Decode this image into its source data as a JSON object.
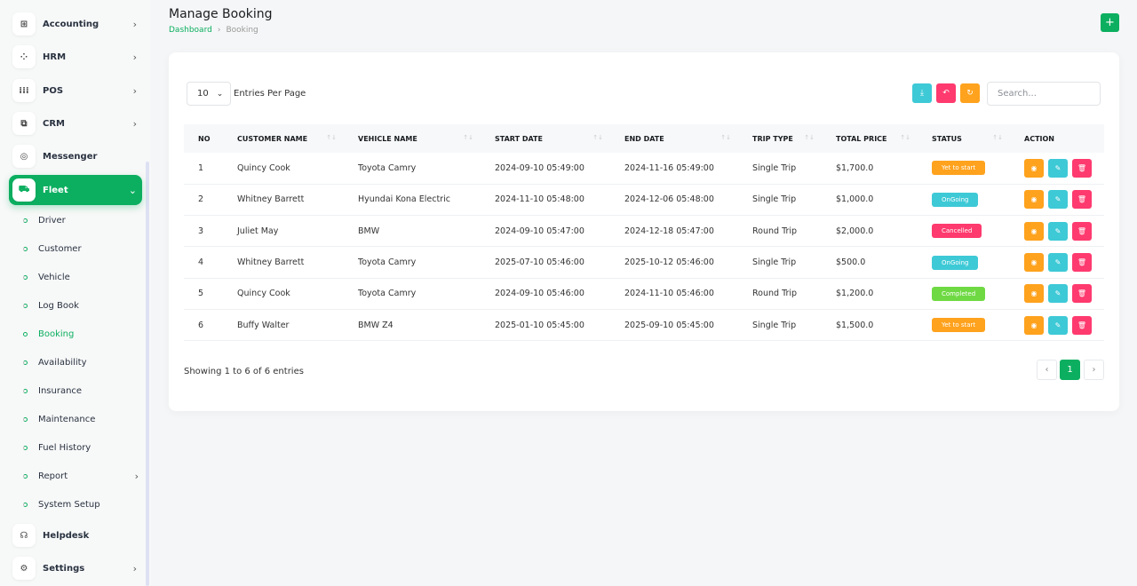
{
  "sidebar": {
    "items": [
      {
        "label": "Accounting",
        "icon": "grid-plus-icon",
        "glyph": "⊞",
        "has_chevron": true
      },
      {
        "label": "HRM",
        "icon": "users-circle-icon",
        "glyph": "⁘",
        "has_chevron": true
      },
      {
        "label": "POS",
        "icon": "dots-grid-icon",
        "glyph": "⁞⁞⁞",
        "has_chevron": true
      },
      {
        "label": "CRM",
        "icon": "layers-icon",
        "glyph": "⧉",
        "has_chevron": true
      },
      {
        "label": "Messenger",
        "icon": "chat-icon",
        "glyph": "◎",
        "has_chevron": false
      },
      {
        "label": "Fleet",
        "icon": "car-icon",
        "glyph": "⛟",
        "has_chevron": true,
        "active": true
      }
    ],
    "fleet_sub": [
      {
        "label": "Driver"
      },
      {
        "label": "Customer"
      },
      {
        "label": "Vehicle"
      },
      {
        "label": "Log Book"
      },
      {
        "label": "Booking",
        "active": true
      },
      {
        "label": "Availability"
      },
      {
        "label": "Insurance"
      },
      {
        "label": "Maintenance"
      },
      {
        "label": "Fuel History"
      },
      {
        "label": "Report",
        "has_chevron": true
      },
      {
        "label": "System Setup"
      }
    ],
    "bottom_items": [
      {
        "label": "Helpdesk",
        "icon": "headphones-icon",
        "glyph": "☊",
        "has_chevron": false
      },
      {
        "label": "Settings",
        "icon": "gear-icon",
        "glyph": "⚙",
        "has_chevron": true
      }
    ],
    "chevron_right": "›",
    "chevron_down": "⌄"
  },
  "header": {
    "title": "Manage Booking",
    "breadcrumb": {
      "home": "Dashboard",
      "separator": "›",
      "current": "Booking"
    },
    "add_glyph": "+"
  },
  "toolbar": {
    "per_page_value": "10",
    "per_page_caret": "⌄",
    "per_page_label": "Entries Per Page",
    "search_placeholder": "Search...",
    "buttons": [
      {
        "name": "export",
        "glyph": "⤓",
        "color": "#3ec9d6"
      },
      {
        "name": "reset",
        "glyph": "↶",
        "color": "#ff3a6e"
      },
      {
        "name": "refresh",
        "glyph": "↻",
        "color": "#ffa21d"
      }
    ]
  },
  "table": {
    "columns": [
      "No",
      "Customer Name",
      "Vehicle Name",
      "Start Date",
      "End Date",
      "Trip Type",
      "Total Price",
      "Status",
      "Action"
    ],
    "sort_glyph": "↑↓",
    "rows": [
      {
        "no": "1",
        "customer": "Quincy Cook",
        "vehicle": "Toyota Camry",
        "start": "2024-09-10 05:49:00",
        "end": "2024-11-16 05:49:00",
        "trip": "Single Trip",
        "price": "$1,700.0",
        "status": "Yet to start",
        "status_color": "#ffa21d"
      },
      {
        "no": "2",
        "customer": "Whitney Barrett",
        "vehicle": "Hyundai Kona Electric",
        "start": "2024-11-10 05:48:00",
        "end": "2024-12-06 05:48:00",
        "trip": "Single Trip",
        "price": "$1,000.0",
        "status": "OnGoing",
        "status_color": "#3ec9d6"
      },
      {
        "no": "3",
        "customer": "Juliet May",
        "vehicle": "BMW",
        "start": "2024-09-10 05:47:00",
        "end": "2024-12-18 05:47:00",
        "trip": "Round Trip",
        "price": "$2,000.0",
        "status": "Cancelled",
        "status_color": "#ff3a6e"
      },
      {
        "no": "4",
        "customer": "Whitney Barrett",
        "vehicle": "Toyota Camry",
        "start": "2025-07-10 05:46:00",
        "end": "2025-10-12 05:46:00",
        "trip": "Single Trip",
        "price": "$500.0",
        "status": "OnGoing",
        "status_color": "#3ec9d6"
      },
      {
        "no": "5",
        "customer": "Quincy Cook",
        "vehicle": "Toyota Camry",
        "start": "2024-09-10 05:46:00",
        "end": "2024-11-10 05:46:00",
        "trip": "Round Trip",
        "price": "$1,200.0",
        "status": "Completed",
        "status_color": "#6fd943"
      },
      {
        "no": "6",
        "customer": "Buffy Walter",
        "vehicle": "BMW Z4",
        "start": "2025-01-10 05:45:00",
        "end": "2025-09-10 05:45:00",
        "trip": "Single Trip",
        "price": "$1,500.0",
        "status": "Yet to start",
        "status_color": "#ffa21d"
      }
    ],
    "actions": [
      {
        "name": "view",
        "glyph": "◉",
        "color": "#ffa21d"
      },
      {
        "name": "edit",
        "glyph": "✎",
        "color": "#3ec9d6"
      },
      {
        "name": "delete",
        "glyph": "🗑",
        "color": "#ff3a6e"
      }
    ]
  },
  "footer": {
    "showing": "Showing 1 to 6 of 6 entries",
    "prev": "‹",
    "current_page": "1",
    "next": "›"
  },
  "colors": {
    "brand": "#0caf60"
  }
}
